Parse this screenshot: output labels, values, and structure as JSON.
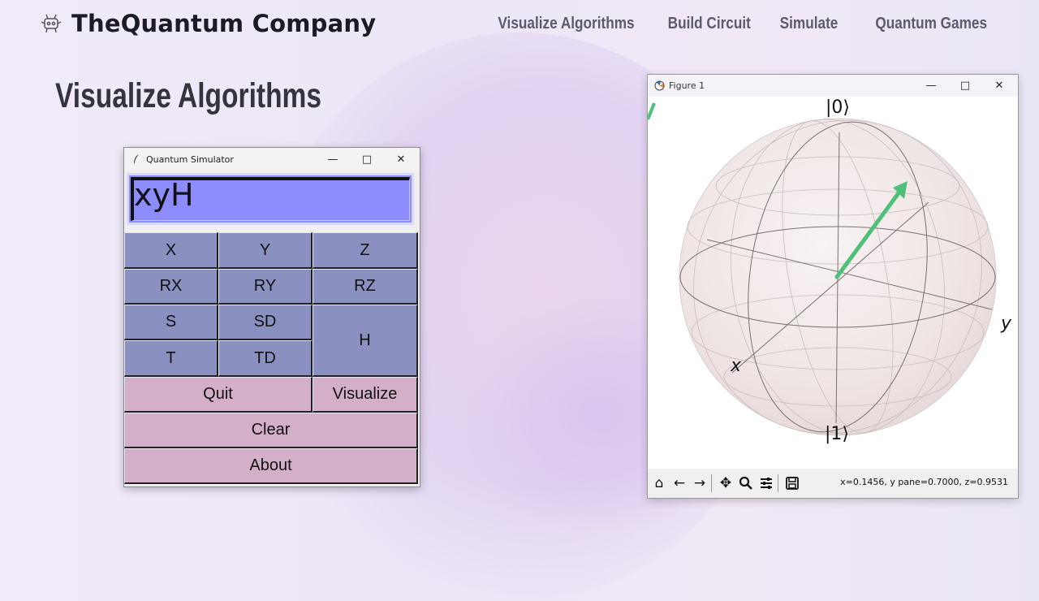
{
  "site": {
    "brand": "TheQuantum Company",
    "nav": [
      "Visualize Algorithms",
      "Build Circuit",
      "Simulate",
      "Quantum Games"
    ],
    "page_title": "Visualize Algorithms"
  },
  "tk_window": {
    "title": "Quantum Simulator",
    "display_value": "xyH",
    "gate_buttons": [
      "X",
      "Y",
      "Z",
      "RX",
      "RY",
      "RZ",
      "S",
      "SD",
      "H",
      "T",
      "TD"
    ],
    "quit": "Quit",
    "visualize": "Visualize",
    "clear": "Clear",
    "about": "About",
    "colors": {
      "gate": "#8a91c1",
      "action": "#d4b0c8",
      "display": "#8c8cff"
    }
  },
  "plot_window": {
    "title": "Figure 1",
    "ket_zero": "|0⟩",
    "ket_one": "|1⟩",
    "axis_x": "x",
    "axis_y": "y",
    "coords": "x=0.1456, y pane=0.7000, z=0.9531",
    "vector_color": "#4fc07a",
    "toolbar_icons": [
      "home-icon",
      "back-icon",
      "forward-icon",
      "pan-icon",
      "zoom-icon",
      "configure-icon",
      "save-icon"
    ]
  }
}
